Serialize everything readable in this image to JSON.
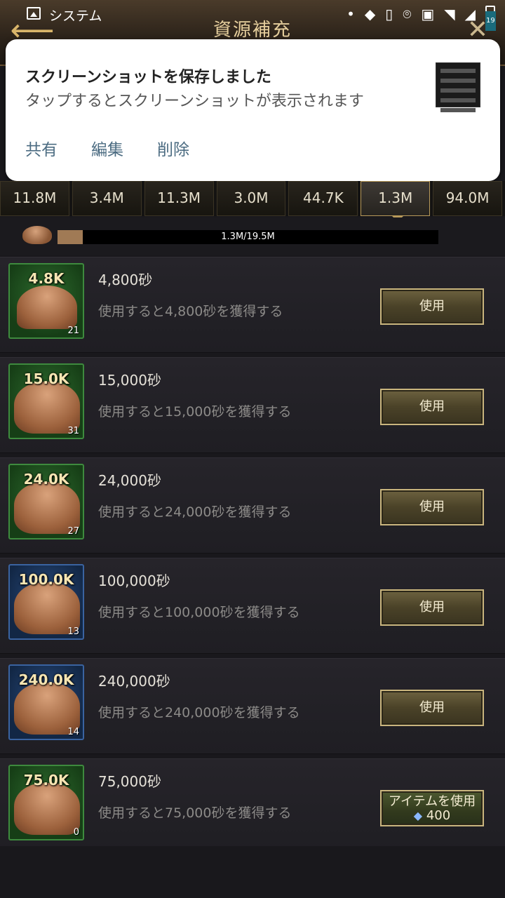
{
  "status_bar": {
    "app_label": "システム",
    "battery_level": "19"
  },
  "header": {
    "title": "資源補充"
  },
  "notification": {
    "title": "スクリーンショットを保存しました",
    "text": "タップするとスクリーンショットが表示されます",
    "actions": [
      "共有",
      "編集",
      "削除"
    ]
  },
  "resource_tabs": [
    {
      "value": "11.8M"
    },
    {
      "value": "3.4M"
    },
    {
      "value": "11.3M"
    },
    {
      "value": "3.0M"
    },
    {
      "value": "44.7K"
    },
    {
      "value": "1.3M",
      "active": true
    },
    {
      "value": "94.0M"
    }
  ],
  "capacity": {
    "text": "1.3M/19.5M",
    "fill_fraction": 0.067
  },
  "items": [
    {
      "badge": "4.8K",
      "qty": "21",
      "name": "4,800砂",
      "desc": "使用すると4,800砂を獲得する",
      "button": "使用",
      "frame": "green"
    },
    {
      "badge": "15.0K",
      "qty": "31",
      "name": "15,000砂",
      "desc": "使用すると15,000砂を獲得する",
      "button": "使用",
      "frame": "green"
    },
    {
      "badge": "24.0K",
      "qty": "27",
      "name": "24,000砂",
      "desc": "使用すると24,000砂を獲得する",
      "button": "使用",
      "frame": "green"
    },
    {
      "badge": "100.0K",
      "qty": "13",
      "name": "100,000砂",
      "desc": "使用すると100,000砂を獲得する",
      "button": "使用",
      "frame": "blue"
    },
    {
      "badge": "240.0K",
      "qty": "14",
      "name": "240,000砂",
      "desc": "使用すると240,000砂を獲得する",
      "button": "使用",
      "frame": "blue"
    },
    {
      "badge": "75.0K",
      "qty": "0",
      "name": "75,000砂",
      "desc": "使用すると75,000砂を獲得する",
      "button": "アイテムを使用",
      "gem_cost": "400",
      "frame": "green"
    }
  ],
  "icons": {
    "back": "back-arrow-icon",
    "close": "close-icon",
    "gem": "diamond-icon",
    "sand": "sand-pile-icon"
  }
}
